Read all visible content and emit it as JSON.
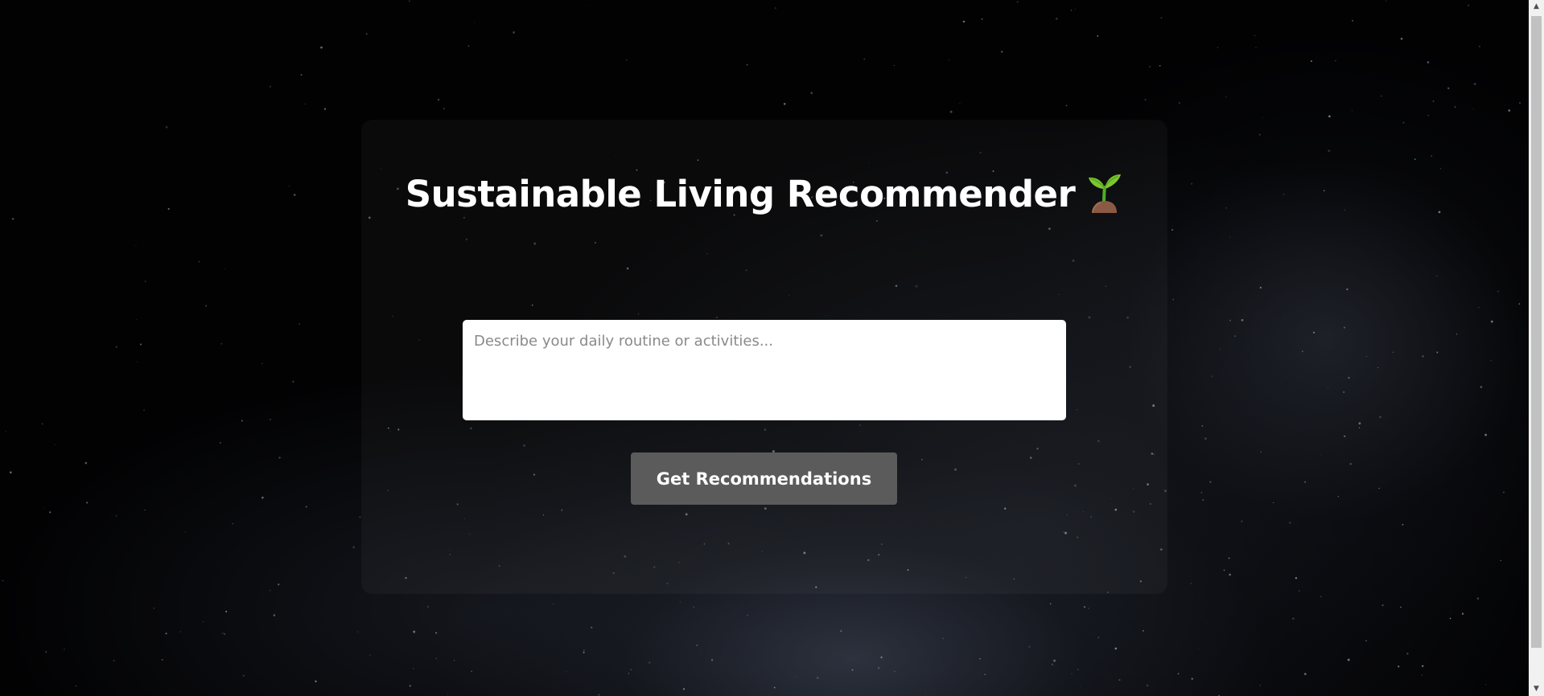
{
  "page": {
    "title": "Sustainable Living Recommender",
    "title_icon": "seedling-icon"
  },
  "form": {
    "routine_placeholder": "Describe your daily routine or activities...",
    "routine_value": "",
    "submit_label": "Get Recommendations"
  },
  "colors": {
    "background": "#020203",
    "title_text": "#ffffff",
    "button_bg": "#5b5b5b",
    "button_text": "#ffffff",
    "input_bg": "#ffffff",
    "placeholder": "#8a8a8a"
  },
  "scrollbar": {
    "up_icon": "chevron-up-icon",
    "down_icon": "chevron-down-icon"
  }
}
